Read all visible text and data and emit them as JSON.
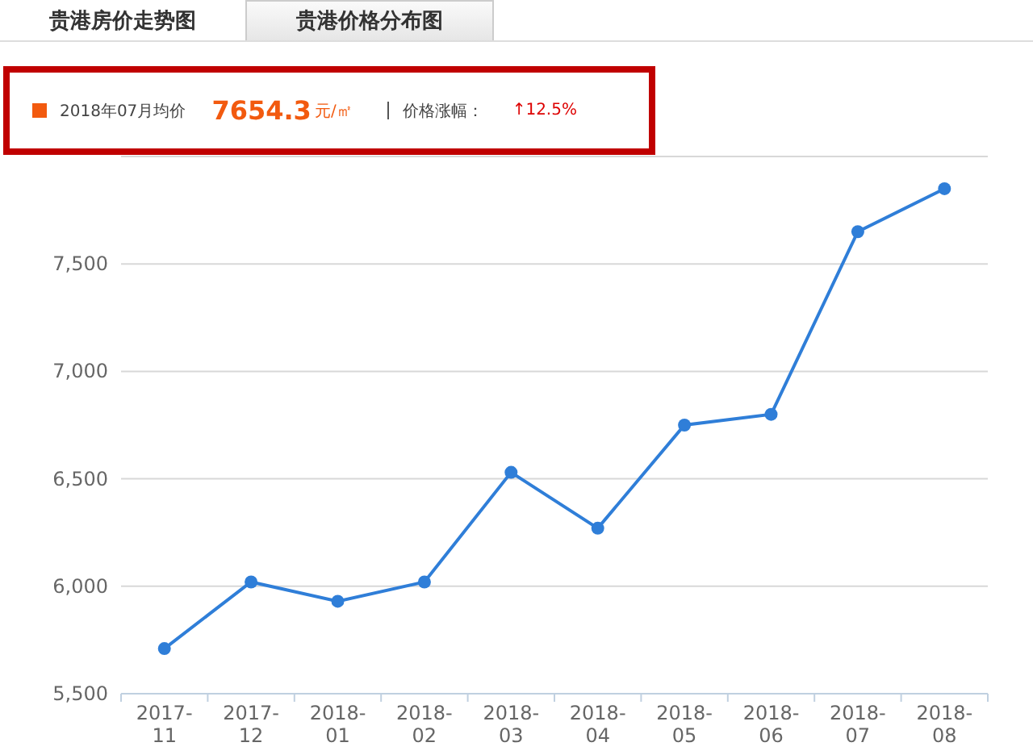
{
  "tabs": [
    {
      "label": "贵港房价走势图",
      "selected": true
    },
    {
      "label": "贵港价格分布图",
      "selected": false
    }
  ],
  "summary": {
    "period": "2018年07月均价",
    "price": "7654.3",
    "unit": "元/㎡",
    "change_label": "价格涨幅：",
    "change_arrow": "↑",
    "change": "12.5%"
  },
  "chart_data": {
    "type": "line",
    "categories": [
      "2017-\n11",
      "2017-\n12",
      "2018-\n01",
      "2018-\n02",
      "2018-\n03",
      "2018-\n04",
      "2018-\n05",
      "2018-\n06",
      "2018-\n07",
      "2018-\n08"
    ],
    "grid": true,
    "series": [
      {
        "color": "#2f7ed8",
        "marker": "circle",
        "values": [
          5710,
          6020,
          5930,
          6020,
          6530,
          6270,
          6750,
          6800,
          7650,
          7850
        ]
      }
    ],
    "ylim": [
      5500,
      8000
    ],
    "yticks": [
      {
        "value": 5500,
        "label": "5,500"
      },
      {
        "value": 6000,
        "label": "6,000"
      },
      {
        "value": 6500,
        "label": "6,500"
      },
      {
        "value": 7000,
        "label": "7,000"
      },
      {
        "value": 7500,
        "label": "7,500"
      }
    ]
  }
}
